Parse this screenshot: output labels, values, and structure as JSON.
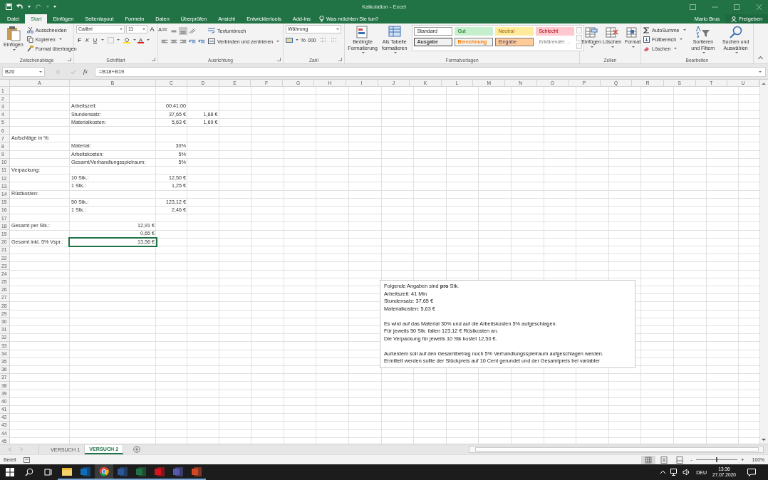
{
  "window": {
    "title": "Kalkulation - Excel",
    "user": "Mario Brus",
    "share": "Freigeben"
  },
  "ribbon_tabs": [
    {
      "label": "Datei",
      "selected": false
    },
    {
      "label": "Start",
      "selected": true
    },
    {
      "label": "Einfügen",
      "selected": false
    },
    {
      "label": "Seitenlayout",
      "selected": false
    },
    {
      "label": "Formeln",
      "selected": false
    },
    {
      "label": "Daten",
      "selected": false
    },
    {
      "label": "Überprüfen",
      "selected": false
    },
    {
      "label": "Ansicht",
      "selected": false
    },
    {
      "label": "Entwicklertools",
      "selected": false
    },
    {
      "label": "Add-Ins",
      "selected": false
    }
  ],
  "tell_me": "Was möchten Sie tun?",
  "clipboard": {
    "label": "Zwischenablage",
    "paste": "Einfügen",
    "cut": "Ausschneiden",
    "copy": "Kopieren",
    "painter": "Format übertragen"
  },
  "font": {
    "label": "Schriftart",
    "family": "Calibri",
    "size": "11",
    "grow": "A",
    "shrink": "A",
    "bold": "F",
    "italic": "K",
    "underline": "U",
    "color_letter": "A"
  },
  "alignment": {
    "label": "Ausrichtung",
    "wrap": "Textumbruch",
    "merge": "Verbinden und zentrieren"
  },
  "number": {
    "label": "Zahl",
    "format": "Währung",
    "percent": "%",
    "thousands": "000"
  },
  "styles": {
    "label": "Formatvorlagen",
    "conditional": "Bedingte Formatierung",
    "table": "Als Tabelle formatieren",
    "cells": [
      {
        "label": "Standard",
        "kind": "standard"
      },
      {
        "label": "Gut",
        "kind": "good"
      },
      {
        "label": "Neutral",
        "kind": "neutral"
      },
      {
        "label": "Schlecht",
        "kind": "bad"
      },
      {
        "label": "Ausgabe",
        "kind": "output"
      },
      {
        "label": "Berechnung",
        "kind": "calculation"
      },
      {
        "label": "Eingabe",
        "kind": "input"
      },
      {
        "label": "Erklärender ...",
        "kind": "explanatory"
      }
    ]
  },
  "cells_group": {
    "label": "Zellen",
    "buttons": [
      "Einfügen",
      "Löschen",
      "Format"
    ]
  },
  "editing": {
    "label": "Bearbeiten",
    "autosum": "AutoSumme",
    "fill": "Füllbereich",
    "clear": "Löschen",
    "sort": "Sortieren und Filtern",
    "find": "Suchen und Auswählen"
  },
  "formula_bar": {
    "name_box": "B20",
    "fx": "fx",
    "formula": "=B18+B19"
  },
  "sheet": {
    "columns": [
      "A",
      "B",
      "C",
      "D",
      "E",
      "F",
      "G",
      "H",
      "I",
      "J",
      "K",
      "L",
      "M",
      "N",
      "O",
      "P",
      "Q",
      "R",
      "S",
      "T",
      "U"
    ],
    "rows": [
      {
        "label": "1"
      },
      {
        "label": "2"
      },
      {
        "label": "3",
        "B": {
          "text": "Arbeitszeit:",
          "kind": "text"
        },
        "C": {
          "text": "00:41:00",
          "kind": "number"
        }
      },
      {
        "label": "4",
        "B": {
          "text": "Stundensatz:",
          "kind": "text"
        },
        "C": {
          "text": "37,65 €",
          "kind": "number"
        },
        "D": {
          "text": "1,88 €",
          "kind": "number"
        }
      },
      {
        "label": "5",
        "B": {
          "text": "Materialkosten:",
          "kind": "text"
        },
        "C": {
          "text": "5,63 €",
          "kind": "number"
        },
        "D": {
          "text": "1,69 €",
          "kind": "number"
        }
      },
      {
        "label": "6"
      },
      {
        "label": "7",
        "A": {
          "text": "Aufschläge in %:",
          "kind": "text"
        }
      },
      {
        "label": "8",
        "B": {
          "text": "Material:",
          "kind": "text"
        },
        "C": {
          "text": "30%",
          "kind": "number"
        }
      },
      {
        "label": "9",
        "B": {
          "text": "Arbeitskosten:",
          "kind": "text"
        },
        "C": {
          "text": "5%",
          "kind": "number"
        }
      },
      {
        "label": "10",
        "B": {
          "text": "Gesamt/Verhandlungsspielraum:",
          "kind": "text"
        },
        "C": {
          "text": "5%",
          "kind": "number"
        }
      },
      {
        "label": "11",
        "A": {
          "text": "Verpackung:",
          "kind": "text"
        }
      },
      {
        "label": "12",
        "B": {
          "text": "10 Stk.:",
          "kind": "text"
        },
        "C": {
          "text": "12,50 €",
          "kind": "number"
        }
      },
      {
        "label": "13",
        "B": {
          "text": "1 Stk.:",
          "kind": "text"
        },
        "C": {
          "text": "1,25 €",
          "kind": "number"
        }
      },
      {
        "label": "14",
        "A": {
          "text": "Rüstkosten:",
          "kind": "text"
        }
      },
      {
        "label": "15",
        "B": {
          "text": "50 Stk.:",
          "kind": "text"
        },
        "C": {
          "text": "123,12 €",
          "kind": "number"
        }
      },
      {
        "label": "16",
        "B": {
          "text": "1 Stk.:",
          "kind": "text"
        },
        "C": {
          "text": "2,46 €",
          "kind": "number"
        }
      },
      {
        "label": "17"
      },
      {
        "label": "18",
        "A": {
          "text": "Gesamt per Stk.:",
          "kind": "text"
        },
        "B": {
          "text": "12,91 €",
          "kind": "number"
        }
      },
      {
        "label": "19",
        "B": {
          "text": "0,65 €",
          "kind": "number"
        }
      },
      {
        "label": "20",
        "A": {
          "text": "Gesamt inkl. 5% Vspr.:",
          "kind": "text"
        },
        "B": {
          "text": "13,56 €",
          "kind": "number",
          "selected": true
        }
      },
      {
        "label": "21"
      },
      {
        "label": "22"
      },
      {
        "label": "23"
      },
      {
        "label": "24"
      },
      {
        "label": "25"
      },
      {
        "label": "26"
      },
      {
        "label": "27"
      },
      {
        "label": "28"
      },
      {
        "label": "29"
      },
      {
        "label": "30"
      },
      {
        "label": "31"
      },
      {
        "label": "32"
      },
      {
        "label": "33"
      },
      {
        "label": "34"
      },
      {
        "label": "35"
      },
      {
        "label": "36"
      },
      {
        "label": "37"
      },
      {
        "label": "38"
      },
      {
        "label": "39"
      },
      {
        "label": "40"
      },
      {
        "label": "41"
      },
      {
        "label": "42"
      },
      {
        "label": "43"
      },
      {
        "label": "44"
      },
      {
        "label": "45"
      }
    ]
  },
  "text_box": {
    "paragraphs": [
      [
        "Folgende Angaben sind **pro** Stk.",
        "Arbeitszeit: 41 Min",
        "Stundensatz: 37,65 €",
        "Materialkosten: 5,63 €"
      ],
      [
        "Es wird auf das Material 30% und auf die Arbeitskosten 5% aufgeschlagen.",
        "Für jeweils 50 Stk. fallen 123,12 € Rüstkosten an.",
        "Die Verpackung für jeweils 10 Stk kostet 12,50 €."
      ],
      [
        "Außerdem soll auf den Gesamtbetrag noch 5% Verhandlungsspielraum aufgeschlagen werden.",
        "Ermittelt werden sollte der Stückpreis auf 10 Cent gerundet und der Gesamtpreis bei variabler"
      ]
    ]
  },
  "sheet_tabs": [
    {
      "label": "VERSUCH 1",
      "selected": false
    },
    {
      "label": "VERSUCH 2",
      "selected": true
    }
  ],
  "status_bar": {
    "status": "Bereit",
    "zoom_out": "-",
    "zoom_in": "+",
    "zoom": "100%",
    "level": 0.5
  },
  "taskbar": {
    "apps": [
      {
        "kind": "explorer",
        "active": false
      },
      {
        "kind": "outlook",
        "active": false
      },
      {
        "kind": "chrome",
        "active": true
      },
      {
        "kind": "word",
        "active": false
      },
      {
        "kind": "excel",
        "active": false
      },
      {
        "kind": "acrobat",
        "active": false
      },
      {
        "kind": "teams",
        "active": false
      },
      {
        "kind": "powerpoint",
        "active": false
      }
    ],
    "language": "DEU",
    "time": "13:36",
    "date": "27.07.2020"
  }
}
